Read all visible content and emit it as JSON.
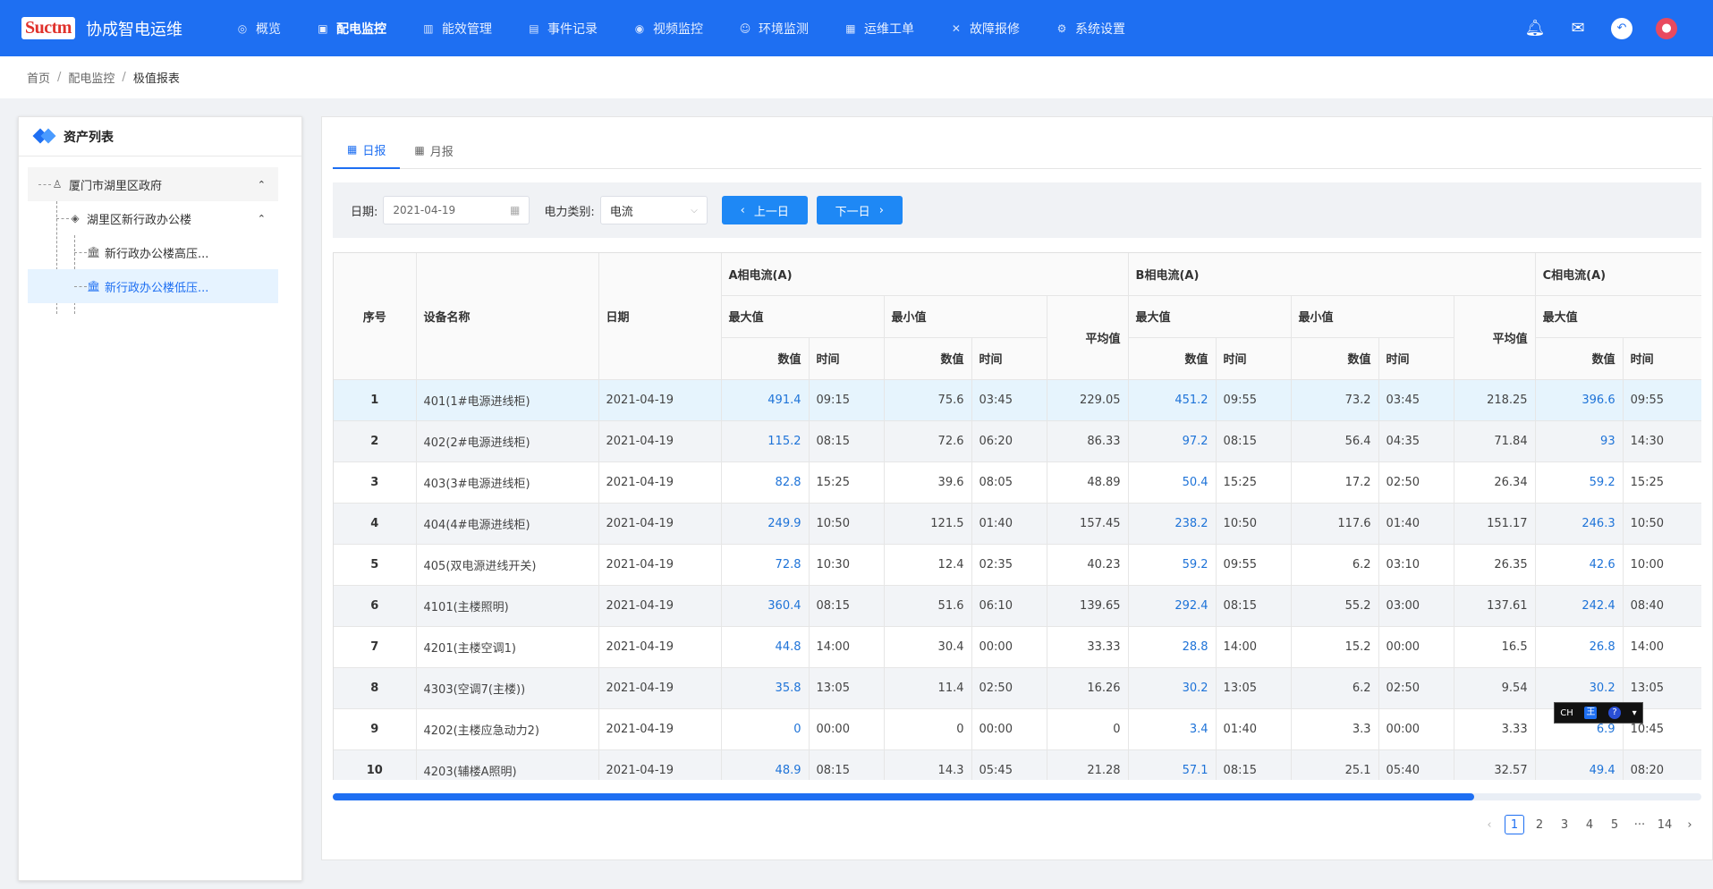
{
  "app": {
    "logo": "Suctm",
    "title": "协成智电运维"
  },
  "nav": [
    {
      "label": "概览",
      "icon": "overview-icon",
      "glyph": "◎",
      "active": false
    },
    {
      "label": "配电监控",
      "icon": "monitor-icon",
      "glyph": "▣",
      "active": true
    },
    {
      "label": "能效管理",
      "icon": "chart-icon",
      "glyph": "▥",
      "active": false
    },
    {
      "label": "事件记录",
      "icon": "record-icon",
      "glyph": "▤",
      "active": false
    },
    {
      "label": "视频监控",
      "icon": "camera-icon",
      "glyph": "◉",
      "active": false
    },
    {
      "label": "环境监测",
      "icon": "environment-icon",
      "glyph": "☺",
      "active": false
    },
    {
      "label": "运维工单",
      "icon": "workorder-icon",
      "glyph": "▦",
      "active": false
    },
    {
      "label": "故障报修",
      "icon": "repair-icon",
      "glyph": "✕",
      "active": false
    },
    {
      "label": "系统设置",
      "icon": "settings-icon",
      "glyph": "⚙",
      "active": false
    }
  ],
  "breadcrumb": [
    "首页",
    "配电监控",
    "极值报表"
  ],
  "asset_panel": {
    "title": "资产列表",
    "tree": [
      {
        "label": "厦门市湖里区政府",
        "level": 0,
        "icon": "user-group-icon",
        "glyph": "♙",
        "expanded": true,
        "selected": false
      },
      {
        "label": "湖里区新行政办公楼",
        "level": 1,
        "icon": "layers-icon",
        "glyph": "◈",
        "expanded": true,
        "selected": false
      },
      {
        "label": "新行政办公楼高压...",
        "level": 2,
        "icon": "bank-icon",
        "glyph": "🏛",
        "selected": false
      },
      {
        "label": "新行政办公楼低压...",
        "level": 2,
        "icon": "bank-icon",
        "glyph": "🏛",
        "selected": true
      }
    ]
  },
  "tabs": [
    {
      "label": "日报",
      "active": true
    },
    {
      "label": "月报",
      "active": false
    }
  ],
  "filter": {
    "date_label": "日期:",
    "date_value": "2021-04-19",
    "type_label": "电力类别:",
    "type_value": "电流",
    "prev_label": "上一日",
    "next_label": "下一日"
  },
  "table": {
    "headers": {
      "index": "序号",
      "device": "设备名称",
      "date": "日期",
      "phase_a": "A相电流(A)",
      "phase_b": "B相电流(A)",
      "phase_c": "C相电流(A)",
      "max": "最大值",
      "min": "最小值",
      "avg": "平均值",
      "value": "数值",
      "time": "时间"
    },
    "rows": [
      {
        "idx": "1",
        "device": "401(1#电源进线柜)",
        "date": "2021-04-19",
        "a_max": "491.4",
        "a_max_t": "09:15",
        "a_min": "75.6",
        "a_min_t": "03:45",
        "a_avg": "229.05",
        "b_max": "451.2",
        "b_max_t": "09:55",
        "b_min": "73.2",
        "b_min_t": "03:45",
        "b_avg": "218.25",
        "c_max": "396.6",
        "c_max_t": "09:55"
      },
      {
        "idx": "2",
        "device": "402(2#电源进线柜)",
        "date": "2021-04-19",
        "a_max": "115.2",
        "a_max_t": "08:15",
        "a_min": "72.6",
        "a_min_t": "06:20",
        "a_avg": "86.33",
        "b_max": "97.2",
        "b_max_t": "08:15",
        "b_min": "56.4",
        "b_min_t": "04:35",
        "b_avg": "71.84",
        "c_max": "93",
        "c_max_t": "14:30"
      },
      {
        "idx": "3",
        "device": "403(3#电源进线柜)",
        "date": "2021-04-19",
        "a_max": "82.8",
        "a_max_t": "15:25",
        "a_min": "39.6",
        "a_min_t": "08:05",
        "a_avg": "48.89",
        "b_max": "50.4",
        "b_max_t": "15:25",
        "b_min": "17.2",
        "b_min_t": "02:50",
        "b_avg": "26.34",
        "c_max": "59.2",
        "c_max_t": "15:25"
      },
      {
        "idx": "4",
        "device": "404(4#电源进线柜)",
        "date": "2021-04-19",
        "a_max": "249.9",
        "a_max_t": "10:50",
        "a_min": "121.5",
        "a_min_t": "01:40",
        "a_avg": "157.45",
        "b_max": "238.2",
        "b_max_t": "10:50",
        "b_min": "117.6",
        "b_min_t": "01:40",
        "b_avg": "151.17",
        "c_max": "246.3",
        "c_max_t": "10:50"
      },
      {
        "idx": "5",
        "device": "405(双电源进线开关)",
        "date": "2021-04-19",
        "a_max": "72.8",
        "a_max_t": "10:30",
        "a_min": "12.4",
        "a_min_t": "02:35",
        "a_avg": "40.23",
        "b_max": "59.2",
        "b_max_t": "09:55",
        "b_min": "6.2",
        "b_min_t": "03:10",
        "b_avg": "26.35",
        "c_max": "42.6",
        "c_max_t": "10:00"
      },
      {
        "idx": "6",
        "device": "4101(主楼照明)",
        "date": "2021-04-19",
        "a_max": "360.4",
        "a_max_t": "08:15",
        "a_min": "51.6",
        "a_min_t": "06:10",
        "a_avg": "139.65",
        "b_max": "292.4",
        "b_max_t": "08:15",
        "b_min": "55.2",
        "b_min_t": "03:00",
        "b_avg": "137.61",
        "c_max": "242.4",
        "c_max_t": "08:40"
      },
      {
        "idx": "7",
        "device": "4201(主楼空调1)",
        "date": "2021-04-19",
        "a_max": "44.8",
        "a_max_t": "14:00",
        "a_min": "30.4",
        "a_min_t": "00:00",
        "a_avg": "33.33",
        "b_max": "28.8",
        "b_max_t": "14:00",
        "b_min": "15.2",
        "b_min_t": "00:00",
        "b_avg": "16.5",
        "c_max": "26.8",
        "c_max_t": "14:00"
      },
      {
        "idx": "8",
        "device": "4303(空调7(主楼))",
        "date": "2021-04-19",
        "a_max": "35.8",
        "a_max_t": "13:05",
        "a_min": "11.4",
        "a_min_t": "02:50",
        "a_avg": "16.26",
        "b_max": "30.2",
        "b_max_t": "13:05",
        "b_min": "6.2",
        "b_min_t": "02:50",
        "b_avg": "9.54",
        "c_max": "30.2",
        "c_max_t": "13:05"
      },
      {
        "idx": "9",
        "device": "4202(主楼应急动力2)",
        "date": "2021-04-19",
        "a_max": "0",
        "a_max_t": "00:00",
        "a_min": "0",
        "a_min_t": "00:00",
        "a_avg": "0",
        "b_max": "3.4",
        "b_max_t": "01:40",
        "b_min": "3.3",
        "b_min_t": "00:00",
        "b_avg": "3.33",
        "c_max": "6.9",
        "c_max_t": "10:45"
      },
      {
        "idx": "10",
        "device": "4203(辅楼A照明)",
        "date": "2021-04-19",
        "a_max": "48.9",
        "a_max_t": "08:15",
        "a_min": "14.3",
        "a_min_t": "05:45",
        "a_avg": "21.28",
        "b_max": "57.1",
        "b_max_t": "08:15",
        "b_min": "25.1",
        "b_min_t": "05:40",
        "b_avg": "32.57",
        "c_max": "49.4",
        "c_max_t": "08:20"
      }
    ]
  },
  "pagination": {
    "current": "1",
    "pages": [
      "1",
      "2",
      "3",
      "4",
      "5"
    ],
    "ellipsis": "···",
    "last": "14"
  },
  "ime": {
    "lang": "CH",
    "mode": "王",
    "help": "?"
  },
  "colors": {
    "primary": "#1e6ff2",
    "link": "#1e73d8"
  }
}
